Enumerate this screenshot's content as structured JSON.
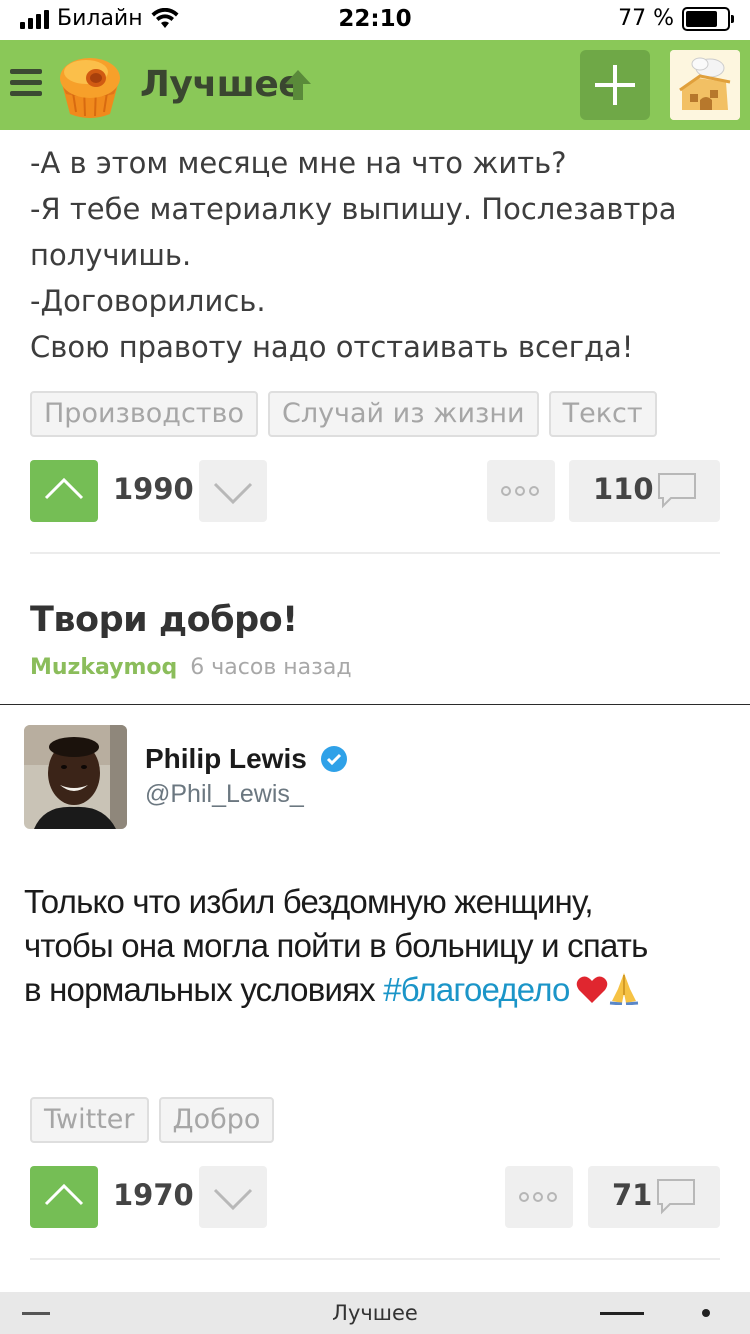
{
  "status_bar": {
    "carrier": "Билайн",
    "time": "22:10",
    "battery": "77 %",
    "battery_level": 0.77
  },
  "header": {
    "title": "Лучшее",
    "brand_color": "#8ac858",
    "add_button_icon": "plus-icon"
  },
  "post1": {
    "lines": [
      "-А в этом месяце мне на что жить?",
      "-Я тебе материалку выпишу. Послезавтра",
      "получишь.",
      "-Договорились.",
      "Свою правоту надо отстаивать всегда!"
    ],
    "tags": [
      "Производство",
      "Случай из жизни",
      "Текст"
    ],
    "rating": "1990",
    "comments": "110"
  },
  "post2": {
    "title": "Твори добро!",
    "author": "Muzkaymoq",
    "time": "6 часов назад",
    "tweet": {
      "name": "Philip Lewis",
      "handle": "@Phil_Lewis_",
      "line1": "Только что избил бездомную женщину,",
      "line2": "чтобы она могла пойти в больницу и спать",
      "line3_text": "в нормальных условиях ",
      "hashtag": "#благоедело"
    },
    "tags": [
      "Twitter",
      "Добро"
    ],
    "rating": "1970",
    "comments": "71"
  },
  "bottom_bar": {
    "title": "Лучшее"
  }
}
